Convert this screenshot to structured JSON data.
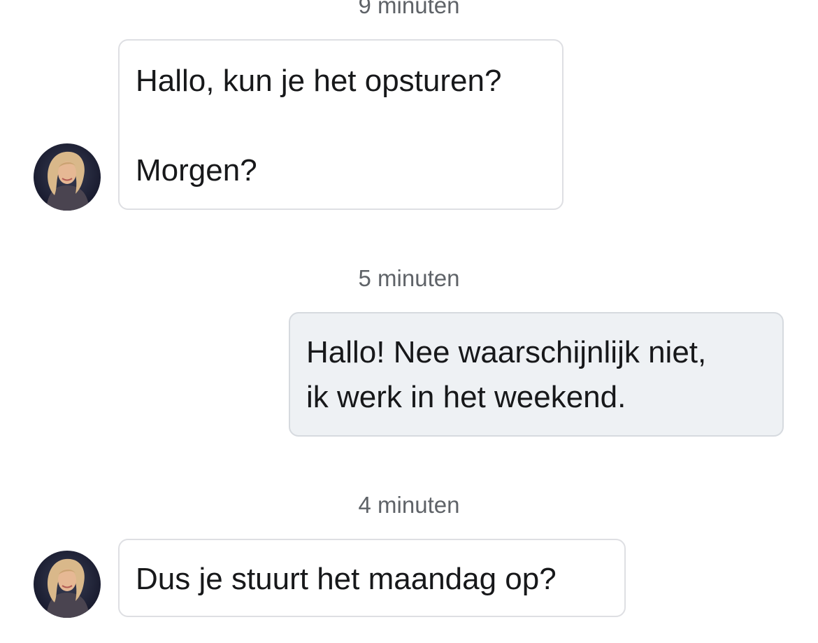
{
  "messages": [
    {
      "timestamp": "9 minuten",
      "direction": "incoming",
      "lines": [
        "Hallo, kun je het opsturen?",
        "",
        "Morgen?"
      ],
      "avatar_icon": "contact-avatar"
    },
    {
      "timestamp": "5 minuten",
      "direction": "outgoing",
      "lines": [
        "Hallo! Nee waarschijnlijk niet,",
        "ik werk in het weekend."
      ]
    },
    {
      "timestamp": "4 minuten",
      "direction": "incoming",
      "lines": [
        "Dus je stuurt het maandag op?"
      ],
      "avatar_icon": "contact-avatar"
    }
  ],
  "colors": {
    "incoming_bubble": "#ffffff",
    "outgoing_bubble": "#eef1f4",
    "bubble_border": "#dedfe3",
    "timestamp_text": "#5f6368",
    "message_text": "#17181a"
  }
}
